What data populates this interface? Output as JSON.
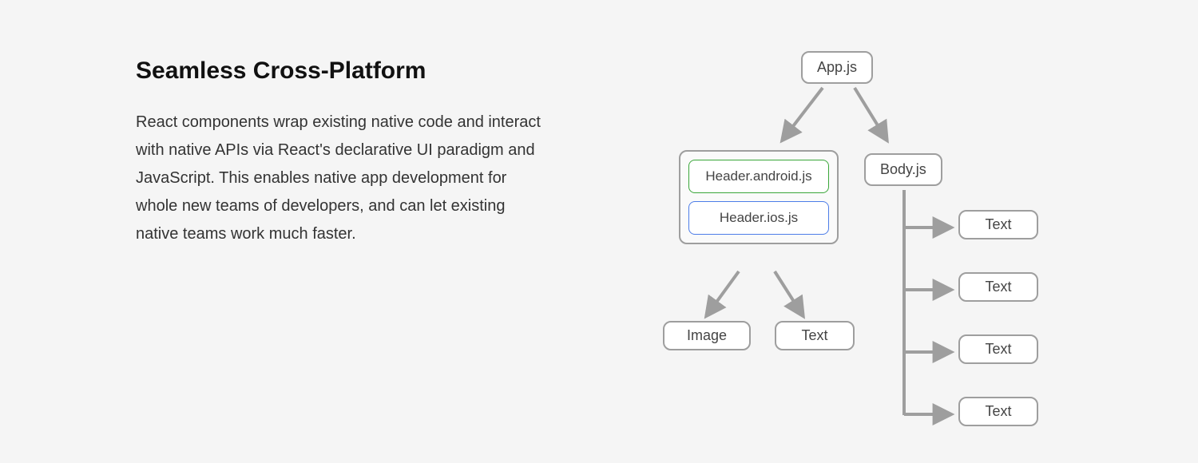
{
  "text": {
    "heading": "Seamless Cross-Platform",
    "body": "React components wrap existing native code and interact with native APIs via React's declarative UI paradigm and JavaScript. This enables native app development for whole new teams of developers, and can let existing native teams work much faster."
  },
  "diagram": {
    "root": "App.js",
    "header_group": {
      "android": "Header.android.js",
      "ios": "Header.ios.js"
    },
    "body_node": "Body.js",
    "header_children": {
      "left": "Image",
      "right": "Text"
    },
    "body_children": [
      "Text",
      "Text",
      "Text",
      "Text"
    ],
    "colors": {
      "node_border": "#9e9e9e",
      "android_border": "#3aa63a",
      "ios_border": "#4d7de8",
      "arrow": "#9e9e9e"
    }
  }
}
